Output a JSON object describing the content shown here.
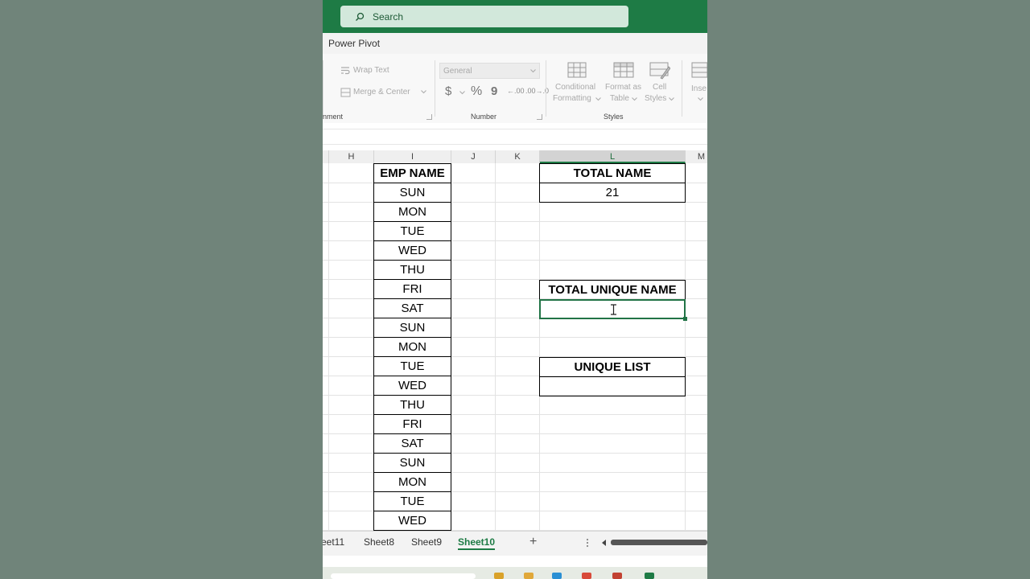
{
  "search": {
    "label": "Search"
  },
  "tabs": {
    "current": "Power Pivot"
  },
  "ribbon": {
    "wrap_text": "Wrap Text",
    "merge_center": "Merge & Center",
    "alignment_group": "nment",
    "number_format": "General",
    "currency": "$",
    "percent": "%",
    "comma": "9",
    "inc_decimal": "←.00",
    "dec_decimal": ".00→.0",
    "number_group": "Number",
    "conditional_formatting": [
      "Conditional",
      "Formatting"
    ],
    "format_as_table": [
      "Format as",
      "Table"
    ],
    "cell_styles": [
      "Cell",
      "Styles"
    ],
    "styles_group": "Styles",
    "insert": "Inse"
  },
  "columns": [
    "H",
    "I",
    "J",
    "K",
    "L",
    "M"
  ],
  "selected_column": "L",
  "emp_list": {
    "header": "EMP NAME",
    "rows": [
      "SUN",
      "MON",
      "TUE",
      "WED",
      "THU",
      "FRI",
      "SAT",
      "SUN",
      "MON",
      "TUE",
      "WED",
      "THU",
      "FRI",
      "SAT",
      "SUN",
      "MON",
      "TUE",
      "WED"
    ]
  },
  "total_name": {
    "header": "TOTAL NAME",
    "value": "21"
  },
  "total_unique": {
    "header": "TOTAL UNIQUE NAME",
    "value": ""
  },
  "unique_list": {
    "header": "UNIQUE LIST",
    "value": ""
  },
  "sheets": [
    "eet11",
    "Sheet8",
    "Sheet9",
    "Sheet10"
  ],
  "active_sheet": "Sheet10",
  "add_sheet": "+",
  "colors": {
    "excel_green": "#1e7b45",
    "selection_green": "#217346",
    "background": "#70847a"
  }
}
